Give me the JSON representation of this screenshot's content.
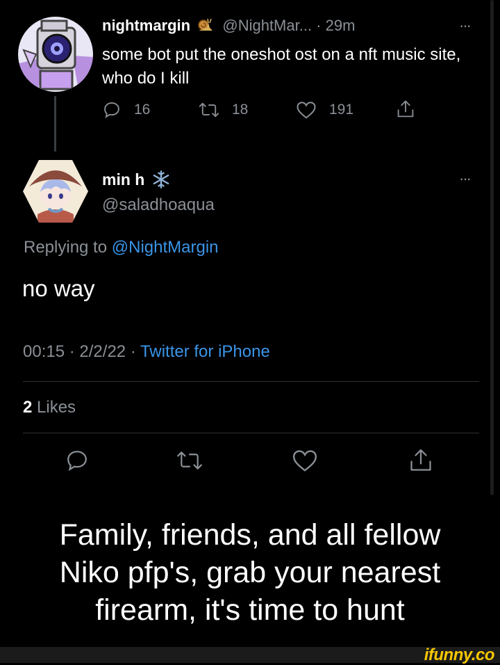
{
  "tweet1": {
    "display_name": "nightmargin",
    "handle": "@NightMar...",
    "separator": "·",
    "time": "29m",
    "more": "···",
    "text": "some bot put the oneshot ost on a nft music site, who do I kill",
    "replies": "16",
    "retweets": "18",
    "likes": "191"
  },
  "tweet2": {
    "display_name": "min h",
    "handle": "@saladhoaqua",
    "more": "···",
    "replying_prefix": "Replying to",
    "replying_handle": "@NightMargin",
    "text": "no way",
    "time": "00:15",
    "separator": "·",
    "date": "2/2/22",
    "source": "Twitter for iPhone",
    "likes_count": "2",
    "likes_label": "Likes"
  },
  "caption": {
    "line1": "Family, friends, and all fellow",
    "line2": "Niko pfp's, grab your nearest",
    "line3": "firearm, it's time to hunt"
  },
  "watermark": "ifunny.co",
  "colors": {
    "background": "#000000",
    "link": "#3b94e6",
    "muted": "#8b9096",
    "watermark": "#f7c600"
  }
}
